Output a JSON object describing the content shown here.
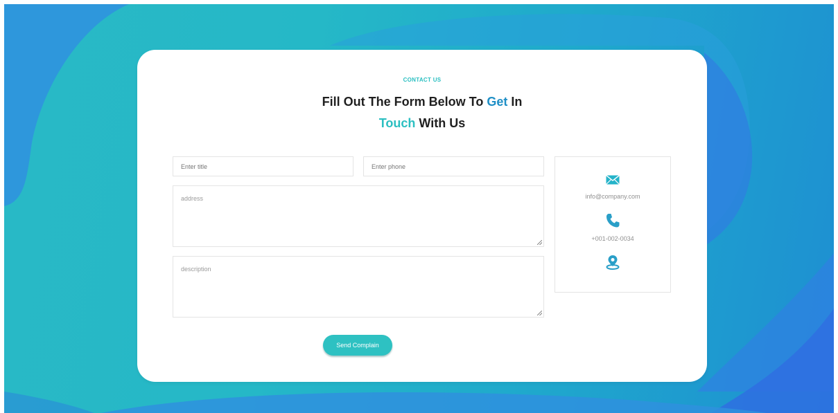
{
  "header": {
    "eyebrow": "CONTACT US",
    "headline_part1": "Fill Out The Form Below To ",
    "headline_highlight1": "Get",
    "headline_part2": " In",
    "headline_highlight2": "Touch",
    "headline_part3": " With Us"
  },
  "form": {
    "title_placeholder": "Enter title",
    "phone_placeholder": "Enter phone",
    "address_placeholder": "address",
    "description_placeholder": "description",
    "submit_label": "Send Complain"
  },
  "contact_info": {
    "email": "info@company.com",
    "phone": "+001-002-0034",
    "icons": [
      "envelope-icon",
      "phone-icon",
      "location-pin-icon"
    ]
  },
  "colors": {
    "accent_teal": "#2bbfc1",
    "accent_blue": "#1f8fc6",
    "heading": "#1f1f1f",
    "background_start": "#29b9c6",
    "background_end": "#1e8fd2"
  }
}
